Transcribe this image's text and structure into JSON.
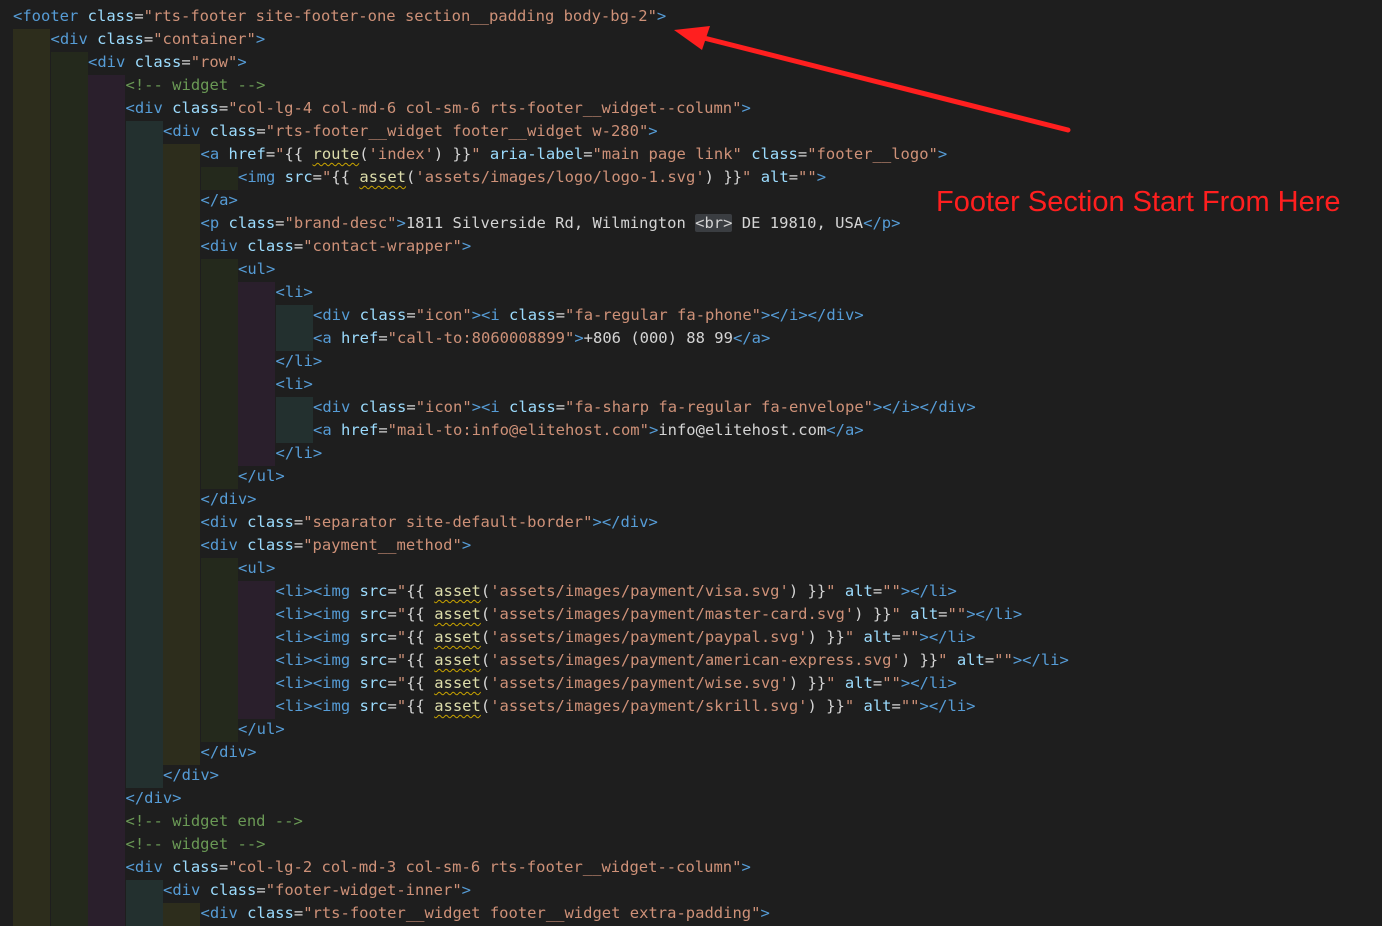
{
  "editor": {
    "background": "#1e1e1e",
    "token_colors": {
      "tag": "#569cd6",
      "attribute": "#9cdcfe",
      "string": "#ce9178",
      "comment": "#6a9955",
      "text": "#d4d4d4",
      "function": "#dcdcaa"
    },
    "indent_guide_colors": [
      "#2d2d1c",
      "#24291c",
      "#2a1f2c",
      "#23302f"
    ],
    "lines": [
      {
        "depth": 0,
        "tokens": [
          [
            "t",
            "<footer "
          ],
          [
            "a",
            "class"
          ],
          [
            "x",
            "="
          ],
          [
            "s",
            "\"rts-footer site-footer-one section__padding body-bg-2\""
          ],
          [
            "t",
            ">"
          ]
        ]
      },
      {
        "depth": 1,
        "tokens": [
          [
            "t",
            "<div "
          ],
          [
            "a",
            "class"
          ],
          [
            "x",
            "="
          ],
          [
            "s",
            "\"container\""
          ],
          [
            "t",
            ">"
          ]
        ]
      },
      {
        "depth": 2,
        "tokens": [
          [
            "t",
            "<div "
          ],
          [
            "a",
            "class"
          ],
          [
            "x",
            "="
          ],
          [
            "s",
            "\"row\""
          ],
          [
            "t",
            ">"
          ]
        ]
      },
      {
        "depth": 3,
        "tokens": [
          [
            "c",
            "<!-- widget -->"
          ]
        ]
      },
      {
        "depth": 3,
        "tokens": [
          [
            "t",
            "<div "
          ],
          [
            "a",
            "class"
          ],
          [
            "x",
            "="
          ],
          [
            "s",
            "\"col-lg-4 col-md-6 col-sm-6 rts-footer__widget--column\""
          ],
          [
            "t",
            ">"
          ]
        ]
      },
      {
        "depth": 4,
        "tokens": [
          [
            "t",
            "<div "
          ],
          [
            "a",
            "class"
          ],
          [
            "x",
            "="
          ],
          [
            "s",
            "\"rts-footer__widget footer__widget w-280\""
          ],
          [
            "t",
            ">"
          ]
        ]
      },
      {
        "depth": 5,
        "tokens": [
          [
            "t",
            "<a "
          ],
          [
            "a",
            "href"
          ],
          [
            "x",
            "="
          ],
          [
            "s",
            "\""
          ],
          [
            "x",
            "{{ "
          ],
          [
            "f",
            "route"
          ],
          [
            "x",
            "("
          ],
          [
            "s",
            "'index'"
          ],
          [
            "x",
            ") }}"
          ],
          [
            "s",
            "\""
          ],
          [
            "x",
            " "
          ],
          [
            "a",
            "aria-label"
          ],
          [
            "x",
            "="
          ],
          [
            "s",
            "\"main page link\""
          ],
          [
            "x",
            " "
          ],
          [
            "a",
            "class"
          ],
          [
            "x",
            "="
          ],
          [
            "s",
            "\"footer__logo\""
          ],
          [
            "t",
            ">"
          ]
        ]
      },
      {
        "depth": 6,
        "tokens": [
          [
            "t",
            "<img "
          ],
          [
            "a",
            "src"
          ],
          [
            "x",
            "="
          ],
          [
            "s",
            "\""
          ],
          [
            "x",
            "{{ "
          ],
          [
            "f",
            "asset"
          ],
          [
            "x",
            "("
          ],
          [
            "s",
            "'assets/images/logo/logo-1.svg'"
          ],
          [
            "x",
            ") }}"
          ],
          [
            "s",
            "\""
          ],
          [
            "x",
            " "
          ],
          [
            "a",
            "alt"
          ],
          [
            "x",
            "="
          ],
          [
            "s",
            "\"\""
          ],
          [
            "t",
            ">"
          ]
        ]
      },
      {
        "depth": 5,
        "tokens": [
          [
            "t",
            "</a>"
          ]
        ]
      },
      {
        "depth": 5,
        "tokens": [
          [
            "t",
            "<p "
          ],
          [
            "a",
            "class"
          ],
          [
            "x",
            "="
          ],
          [
            "s",
            "\"brand-desc\""
          ],
          [
            "t",
            ">"
          ],
          [
            "x",
            "1811 Silverside Rd, Wilmington "
          ],
          [
            "h",
            "<br>"
          ],
          [
            "x",
            " DE 19810, USA"
          ],
          [
            "t",
            "</p>"
          ]
        ]
      },
      {
        "depth": 5,
        "tokens": [
          [
            "t",
            "<div "
          ],
          [
            "a",
            "class"
          ],
          [
            "x",
            "="
          ],
          [
            "s",
            "\"contact-wrapper\""
          ],
          [
            "t",
            ">"
          ]
        ]
      },
      {
        "depth": 6,
        "tokens": [
          [
            "t",
            "<ul>"
          ]
        ]
      },
      {
        "depth": 7,
        "tokens": [
          [
            "t",
            "<li>"
          ]
        ]
      },
      {
        "depth": 8,
        "tokens": [
          [
            "t",
            "<div "
          ],
          [
            "a",
            "class"
          ],
          [
            "x",
            "="
          ],
          [
            "s",
            "\"icon\""
          ],
          [
            "t",
            ">"
          ],
          [
            "t",
            "<i "
          ],
          [
            "a",
            "class"
          ],
          [
            "x",
            "="
          ],
          [
            "s",
            "\"fa-regular fa-phone\""
          ],
          [
            "t",
            "></i></div>"
          ]
        ]
      },
      {
        "depth": 8,
        "tokens": [
          [
            "t",
            "<a "
          ],
          [
            "a",
            "href"
          ],
          [
            "x",
            "="
          ],
          [
            "s",
            "\"call-to:8060008899\""
          ],
          [
            "t",
            ">"
          ],
          [
            "x",
            "+806 (000) 88 99"
          ],
          [
            "t",
            "</a>"
          ]
        ]
      },
      {
        "depth": 7,
        "tokens": [
          [
            "t",
            "</li>"
          ]
        ]
      },
      {
        "depth": 7,
        "tokens": [
          [
            "t",
            "<li>"
          ]
        ]
      },
      {
        "depth": 8,
        "tokens": [
          [
            "t",
            "<div "
          ],
          [
            "a",
            "class"
          ],
          [
            "x",
            "="
          ],
          [
            "s",
            "\"icon\""
          ],
          [
            "t",
            ">"
          ],
          [
            "t",
            "<i "
          ],
          [
            "a",
            "class"
          ],
          [
            "x",
            "="
          ],
          [
            "s",
            "\"fa-sharp fa-regular fa-envelope\""
          ],
          [
            "t",
            "></i></div>"
          ]
        ]
      },
      {
        "depth": 8,
        "tokens": [
          [
            "t",
            "<a "
          ],
          [
            "a",
            "href"
          ],
          [
            "x",
            "="
          ],
          [
            "s",
            "\"mail-to:info@elitehost.com\""
          ],
          [
            "t",
            ">"
          ],
          [
            "x",
            "info@elitehost.com"
          ],
          [
            "t",
            "</a>"
          ]
        ]
      },
      {
        "depth": 7,
        "tokens": [
          [
            "t",
            "</li>"
          ]
        ]
      },
      {
        "depth": 6,
        "tokens": [
          [
            "t",
            "</ul>"
          ]
        ]
      },
      {
        "depth": 5,
        "tokens": [
          [
            "t",
            "</div>"
          ]
        ]
      },
      {
        "depth": 5,
        "tokens": [
          [
            "t",
            "<div "
          ],
          [
            "a",
            "class"
          ],
          [
            "x",
            "="
          ],
          [
            "s",
            "\"separator site-default-border\""
          ],
          [
            "t",
            "></div>"
          ]
        ]
      },
      {
        "depth": 5,
        "tokens": [
          [
            "t",
            "<div "
          ],
          [
            "a",
            "class"
          ],
          [
            "x",
            "="
          ],
          [
            "s",
            "\"payment__method\""
          ],
          [
            "t",
            ">"
          ]
        ]
      },
      {
        "depth": 6,
        "tokens": [
          [
            "t",
            "<ul>"
          ]
        ]
      },
      {
        "depth": 7,
        "tokens": [
          [
            "t",
            "<li><img "
          ],
          [
            "a",
            "src"
          ],
          [
            "x",
            "="
          ],
          [
            "s",
            "\""
          ],
          [
            "x",
            "{{ "
          ],
          [
            "f",
            "asset"
          ],
          [
            "x",
            "("
          ],
          [
            "s",
            "'assets/images/payment/visa.svg'"
          ],
          [
            "x",
            ") }}"
          ],
          [
            "s",
            "\""
          ],
          [
            "x",
            " "
          ],
          [
            "a",
            "alt"
          ],
          [
            "x",
            "="
          ],
          [
            "s",
            "\"\""
          ],
          [
            "t",
            "></li>"
          ]
        ]
      },
      {
        "depth": 7,
        "tokens": [
          [
            "t",
            "<li><img "
          ],
          [
            "a",
            "src"
          ],
          [
            "x",
            "="
          ],
          [
            "s",
            "\""
          ],
          [
            "x",
            "{{ "
          ],
          [
            "f",
            "asset"
          ],
          [
            "x",
            "("
          ],
          [
            "s",
            "'assets/images/payment/master-card.svg'"
          ],
          [
            "x",
            ") }}"
          ],
          [
            "s",
            "\""
          ],
          [
            "x",
            " "
          ],
          [
            "a",
            "alt"
          ],
          [
            "x",
            "="
          ],
          [
            "s",
            "\"\""
          ],
          [
            "t",
            "></li>"
          ]
        ]
      },
      {
        "depth": 7,
        "tokens": [
          [
            "t",
            "<li><img "
          ],
          [
            "a",
            "src"
          ],
          [
            "x",
            "="
          ],
          [
            "s",
            "\""
          ],
          [
            "x",
            "{{ "
          ],
          [
            "f",
            "asset"
          ],
          [
            "x",
            "("
          ],
          [
            "s",
            "'assets/images/payment/paypal.svg'"
          ],
          [
            "x",
            ") }}"
          ],
          [
            "s",
            "\""
          ],
          [
            "x",
            " "
          ],
          [
            "a",
            "alt"
          ],
          [
            "x",
            "="
          ],
          [
            "s",
            "\"\""
          ],
          [
            "t",
            "></li>"
          ]
        ]
      },
      {
        "depth": 7,
        "tokens": [
          [
            "t",
            "<li><img "
          ],
          [
            "a",
            "src"
          ],
          [
            "x",
            "="
          ],
          [
            "s",
            "\""
          ],
          [
            "x",
            "{{ "
          ],
          [
            "f",
            "asset"
          ],
          [
            "x",
            "("
          ],
          [
            "s",
            "'assets/images/payment/american-express.svg'"
          ],
          [
            "x",
            ") }}"
          ],
          [
            "s",
            "\""
          ],
          [
            "x",
            " "
          ],
          [
            "a",
            "alt"
          ],
          [
            "x",
            "="
          ],
          [
            "s",
            "\"\""
          ],
          [
            "t",
            "></li>"
          ]
        ]
      },
      {
        "depth": 7,
        "tokens": [
          [
            "t",
            "<li><img "
          ],
          [
            "a",
            "src"
          ],
          [
            "x",
            "="
          ],
          [
            "s",
            "\""
          ],
          [
            "x",
            "{{ "
          ],
          [
            "f",
            "asset"
          ],
          [
            "x",
            "("
          ],
          [
            "s",
            "'assets/images/payment/wise.svg'"
          ],
          [
            "x",
            ") }}"
          ],
          [
            "s",
            "\""
          ],
          [
            "x",
            " "
          ],
          [
            "a",
            "alt"
          ],
          [
            "x",
            "="
          ],
          [
            "s",
            "\"\""
          ],
          [
            "t",
            "></li>"
          ]
        ]
      },
      {
        "depth": 7,
        "tokens": [
          [
            "t",
            "<li><img "
          ],
          [
            "a",
            "src"
          ],
          [
            "x",
            "="
          ],
          [
            "s",
            "\""
          ],
          [
            "x",
            "{{ "
          ],
          [
            "f",
            "asset"
          ],
          [
            "x",
            "("
          ],
          [
            "s",
            "'assets/images/payment/skrill.svg'"
          ],
          [
            "x",
            ") }}"
          ],
          [
            "s",
            "\""
          ],
          [
            "x",
            " "
          ],
          [
            "a",
            "alt"
          ],
          [
            "x",
            "="
          ],
          [
            "s",
            "\"\""
          ],
          [
            "t",
            "></li>"
          ]
        ]
      },
      {
        "depth": 6,
        "tokens": [
          [
            "t",
            "</ul>"
          ]
        ]
      },
      {
        "depth": 5,
        "tokens": [
          [
            "t",
            "</div>"
          ]
        ]
      },
      {
        "depth": 4,
        "tokens": [
          [
            "t",
            "</div>"
          ]
        ]
      },
      {
        "depth": 3,
        "tokens": [
          [
            "t",
            "</div>"
          ]
        ]
      },
      {
        "depth": 3,
        "tokens": [
          [
            "c",
            "<!-- widget end -->"
          ]
        ]
      },
      {
        "depth": 3,
        "tokens": [
          [
            "c",
            "<!-- widget -->"
          ]
        ]
      },
      {
        "depth": 3,
        "tokens": [
          [
            "t",
            "<div "
          ],
          [
            "a",
            "class"
          ],
          [
            "x",
            "="
          ],
          [
            "s",
            "\"col-lg-2 col-md-3 col-sm-6 rts-footer__widget--column\""
          ],
          [
            "t",
            ">"
          ]
        ]
      },
      {
        "depth": 4,
        "tokens": [
          [
            "t",
            "<div "
          ],
          [
            "a",
            "class"
          ],
          [
            "x",
            "="
          ],
          [
            "s",
            "\"footer-widget-inner\""
          ],
          [
            "t",
            ">"
          ]
        ]
      },
      {
        "depth": 5,
        "tokens": [
          [
            "t",
            "<div "
          ],
          [
            "a",
            "class"
          ],
          [
            "x",
            "="
          ],
          [
            "s",
            "\"rts-footer__widget footer__widget extra-padding\""
          ],
          [
            "t",
            ">"
          ]
        ]
      }
    ]
  },
  "annotation": {
    "text": "Footer Section Start From Here",
    "color": "#ff1f1f"
  }
}
